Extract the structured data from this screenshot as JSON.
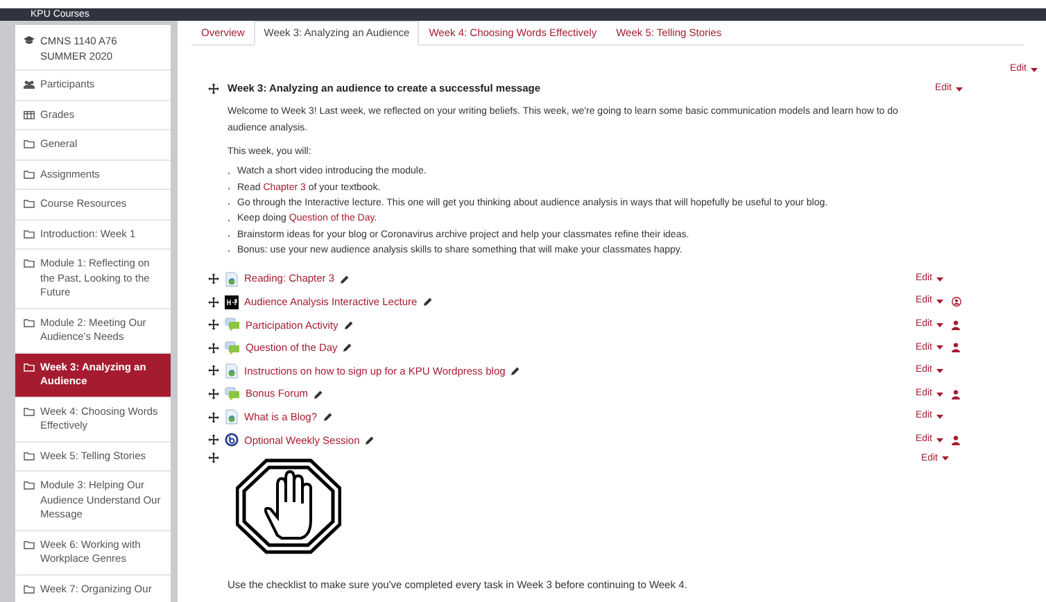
{
  "topbar": {
    "title": "KPU Courses"
  },
  "sidebar": {
    "course": "CMNS 1140 A76 SUMMER 2020",
    "items": [
      {
        "label": "Participants",
        "kind": "participants",
        "selected": false
      },
      {
        "label": "Grades",
        "kind": "grades",
        "selected": false
      },
      {
        "label": "General",
        "kind": "section",
        "selected": false
      },
      {
        "label": "Assignments",
        "kind": "section",
        "selected": false
      },
      {
        "label": "Course Resources",
        "kind": "section",
        "selected": false
      },
      {
        "label": "Introduction: Week 1",
        "kind": "section",
        "selected": false
      },
      {
        "label": "Module 1: Reflecting on the Past, Looking to the Future",
        "kind": "section",
        "selected": false
      },
      {
        "label": "Module 2: Meeting Our Audience's Needs",
        "kind": "section",
        "selected": false
      },
      {
        "label": "Week 3: Analyzing an Audience",
        "kind": "section",
        "selected": true
      },
      {
        "label": "Week 4: Choosing Words Effectively",
        "kind": "section",
        "selected": false
      },
      {
        "label": "Week 5: Telling Stories",
        "kind": "section",
        "selected": false
      },
      {
        "label": "Module 3: Helping Our Audience Understand Our Message",
        "kind": "section",
        "selected": false
      },
      {
        "label": "Week 6: Working with Workplace Genres",
        "kind": "section",
        "selected": false
      },
      {
        "label": "Week 7: Organizing Our",
        "kind": "section",
        "selected": false
      }
    ]
  },
  "tabs": [
    {
      "label": "Overview",
      "selected": false
    },
    {
      "label": "Week 3: Analyzing an Audience",
      "selected": true
    },
    {
      "label": "Week 4: Choosing Words Effectively",
      "selected": false
    },
    {
      "label": "Week 5: Telling Stories",
      "selected": false
    }
  ],
  "page_edit": "Edit",
  "section": {
    "title": "Week 3: Analyzing an audience to create a successful message",
    "edit": "Edit",
    "intro": "Welcome to Week 3! Last week, we reflected on your writing beliefs. This week, we're going to learn some basic communication models and learn how to do audience analysis.",
    "lead": "This week, you will:",
    "bullets": [
      [
        {
          "text": "Watch a short video introducing the module."
        }
      ],
      [
        {
          "text": "Read "
        },
        {
          "text": "Chapter 3",
          "link": true
        },
        {
          "text": " of your textbook."
        }
      ],
      [
        {
          "text": "Go through the Interactive lecture. This one will get you thinking about audience analysis in ways that will hopefully be useful to your blog."
        }
      ],
      [
        {
          "text": "Keep doing "
        },
        {
          "text": "Question of the Day",
          "link": true
        },
        {
          "text": "."
        }
      ],
      [
        {
          "text": "Brainstorm ideas for your blog or Coronavirus archive project and help your classmates refine their ideas."
        }
      ],
      [
        {
          "text": "Bonus: use your new audience analysis skills to share something that will make your classmates happy."
        }
      ]
    ]
  },
  "activities": [
    {
      "kind": "page",
      "title": "Reading: Chapter 3",
      "edit": "Edit",
      "restricted": false
    },
    {
      "kind": "h5p",
      "title": "Audience Analysis Interactive Lecture",
      "edit": "Edit",
      "restricted": true
    },
    {
      "kind": "forum",
      "title": "Participation Activity",
      "edit": "Edit",
      "restricted": true
    },
    {
      "kind": "forum",
      "title": "Question of the Day",
      "edit": "Edit",
      "restricted": true
    },
    {
      "kind": "page",
      "title": "Instructions on how to sign up for a KPU Wordpress blog",
      "edit": "Edit",
      "restricted": false
    },
    {
      "kind": "forum",
      "title": "Bonus Forum",
      "edit": "Edit",
      "restricted": true
    },
    {
      "kind": "page",
      "title": "What is a Blog?",
      "edit": "Edit",
      "restricted": false
    },
    {
      "kind": "session",
      "title": "Optional Weekly Session",
      "edit": "Edit",
      "restricted": true
    }
  ],
  "label_block": {
    "edit": "Edit",
    "text": "Use the checklist to make sure you've completed every task in Week 3 before continuing to Week 4."
  }
}
